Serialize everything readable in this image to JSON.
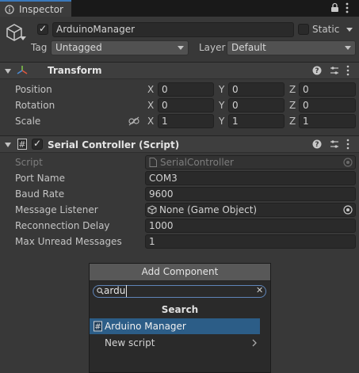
{
  "tab": {
    "title": "Inspector",
    "icon": "info-icon"
  },
  "header": {
    "active": true,
    "name": "ArduinoManager",
    "static_label": "Static",
    "tag_label": "Tag",
    "tag_value": "Untagged",
    "layer_label": "Layer",
    "layer_value": "Default"
  },
  "transform": {
    "title": "Transform",
    "rows": [
      {
        "label": "Position",
        "x": "0",
        "y": "0",
        "z": "0"
      },
      {
        "label": "Rotation",
        "x": "0",
        "y": "0",
        "z": "0"
      },
      {
        "label": "Scale",
        "x": "1",
        "y": "1",
        "z": "1"
      }
    ],
    "axes": {
      "x": "X",
      "y": "Y",
      "z": "Z"
    }
  },
  "serial": {
    "title": "Serial Controller (Script)",
    "enabled": true,
    "script_label": "Script",
    "script_value": "SerialController",
    "port_label": "Port Name",
    "port_value": "COM3",
    "baud_label": "Baud Rate",
    "baud_value": "9600",
    "listener_label": "Message Listener",
    "listener_value": "None (Game Object)",
    "delay_label": "Reconnection Delay",
    "delay_value": "1000",
    "maxmsg_label": "Max Unread Messages",
    "maxmsg_value": "1"
  },
  "add_component": {
    "button_label": "Add Component",
    "search_value": "ardu",
    "results_title": "Search",
    "results": [
      {
        "label": "Arduino Manager",
        "icon": "script-hash-icon"
      },
      {
        "label": "New script",
        "icon": "chevron-right-icon"
      }
    ]
  },
  "colors": {
    "accent": "#3a79bb",
    "selection": "#2c5d87",
    "background": "#383838"
  }
}
